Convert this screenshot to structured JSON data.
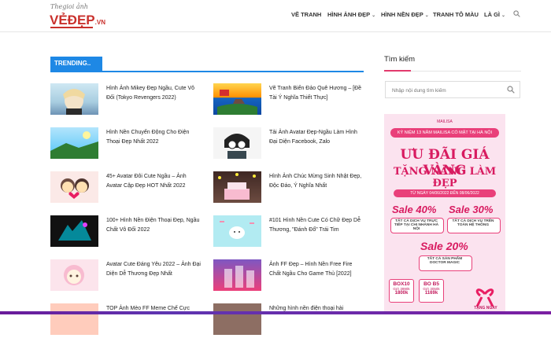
{
  "header": {
    "logo_top": "Thegioi ảnh",
    "logo_main": "VẺĐẸP",
    "logo_suffix": ".VN",
    "nav": [
      {
        "label": "VẼ TRANH",
        "has_dropdown": false
      },
      {
        "label": "HÌNH ẢNH ĐẸP",
        "has_dropdown": true
      },
      {
        "label": "HÌNH NỀN ĐẸP",
        "has_dropdown": true
      },
      {
        "label": "TRANH TÔ MÀU",
        "has_dropdown": false
      },
      {
        "label": "LÀ GÌ",
        "has_dropdown": true
      }
    ]
  },
  "trending": {
    "label": "TRENDING..",
    "posts": [
      {
        "title": "Hình Ảnh Mikey Đẹp Ngầu, Cute Vô Đối (Tokyo Revengers 2022)"
      },
      {
        "title": "Vẽ Tranh Biển Đảo Quê Hương – [Đề Tài Ý Nghĩa Thiết Thực]"
      },
      {
        "title": "Hình Nền Chuyển Động Cho Điện Thoại Đẹp Nhất 2022"
      },
      {
        "title": "Tải Ảnh Avatar Đẹp-Ngầu Làm Hình Đại Diện Facebook, Zalo"
      },
      {
        "title": "45+ Avatar Đôi Cute Ngầu – Ảnh Avatar Cặp Đẹp HOT Nhất 2022"
      },
      {
        "title": "Hình Ảnh Chúc Mừng Sinh Nhật Đẹp, Độc Đáo, Ý Nghĩa Nhất"
      },
      {
        "title": "100+ Hình Nền Điện Thoại Đẹp, Ngầu Chất Vô Đối 2022"
      },
      {
        "title": "#101 Hình Nền Cute Có Chữ Đẹp Dễ Thương, \"Đánh Đổ\" Trái Tim"
      },
      {
        "title": "Avatar Cute Đáng Yêu 2022 – Ảnh Đại Diện Dễ Thương Đẹp Nhất"
      },
      {
        "title": "Ảnh FF Đẹp – Hình Nền Free Fire Chất Ngầu Cho Game Thủ [2022]"
      },
      {
        "title": "TOP Ảnh Mèo FF Meme Chế Cực"
      },
      {
        "title": "Những hình nền điện thoại hài"
      }
    ]
  },
  "sidebar": {
    "title": "Tìm kiếm",
    "search_placeholder": "Nhập nội dung tìm kiếm"
  },
  "ad": {
    "top_text": "MAILISA",
    "ribbon": "KỶ NIỆM 13 NĂM MAILISA CÓ MẶT TẠI HÀ NỘI",
    "headline1": "ƯU ĐÃI GIÁ VÀNG",
    "headline2": "TẶNG NÀNG LÀM ĐẸP",
    "date": "TỪ NGÀY 04/06/2022 ĐẾN 08/06/2022",
    "sale1": "Sale 40%",
    "sale1_sub": "TẤT CẢ DỊCH VỤ TRỰC TIẾP TẠI CHI NHÁNH HÀ NỘI",
    "sale2": "Sale 30%",
    "sale2_sub": "TẤT CẢ DỊCH VỤ TRÊN TOÀN HỆ THỐNG",
    "sale3": "Sale 20%",
    "sale3_sub": "TẤT CẢ SẢN PHẨM DOCTOR MAGIC",
    "price1_name": "BOX10",
    "price1_old": "GIÁ 3990k",
    "price1": "1800k",
    "price2_name": "BO B5",
    "price2_old": "GIÁ 3050k",
    "price2": "1169k",
    "gift_label": "TẶNG NGAY"
  },
  "colors": {
    "accent": "#1e88e5",
    "brand": "#c9302c",
    "pink": "#e9407a"
  }
}
